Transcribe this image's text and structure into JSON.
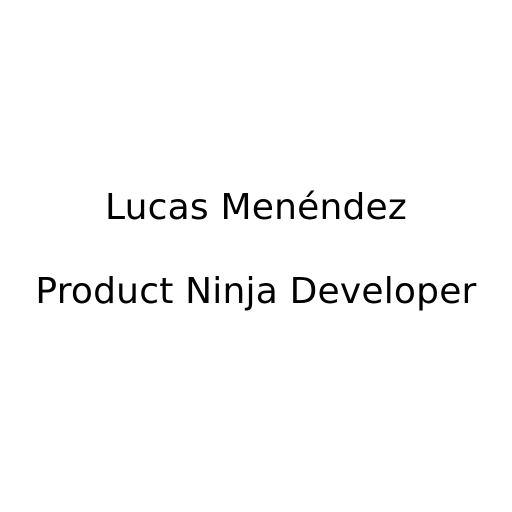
{
  "profile": {
    "name": "Lucas Menéndez",
    "title": "Product Ninja Developer"
  },
  "colors": {
    "background": "#ffffff",
    "text": "#000000"
  }
}
